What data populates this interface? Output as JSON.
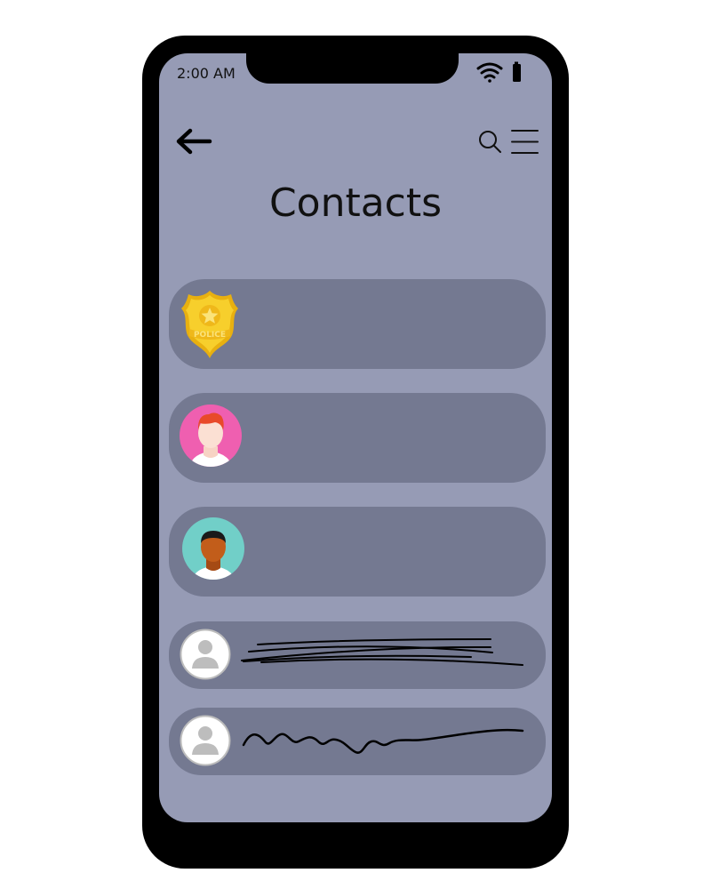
{
  "status_bar": {
    "time": "2:00 AM",
    "wifi_icon": "wifi-icon",
    "battery_icon": "battery-icon"
  },
  "header": {
    "back_icon": "back-arrow-icon",
    "search_icon": "search-icon",
    "menu_icon": "menu-icon",
    "title": "Contacts"
  },
  "contacts": [
    {
      "avatar": "police-badge-icon",
      "badge_text": "POLICE",
      "name": ""
    },
    {
      "avatar": "avatar-red-hair-pink-bg",
      "name": ""
    },
    {
      "avatar": "avatar-dark-skin-teal-bg",
      "name": ""
    },
    {
      "avatar": "default-user-avatar",
      "name_scribbled": true
    },
    {
      "avatar": "default-user-avatar",
      "name_scribbled": true
    }
  ],
  "colors": {
    "screen_bg": "#969bb5",
    "row_bg": "#747991",
    "phone_frame": "#000000"
  }
}
